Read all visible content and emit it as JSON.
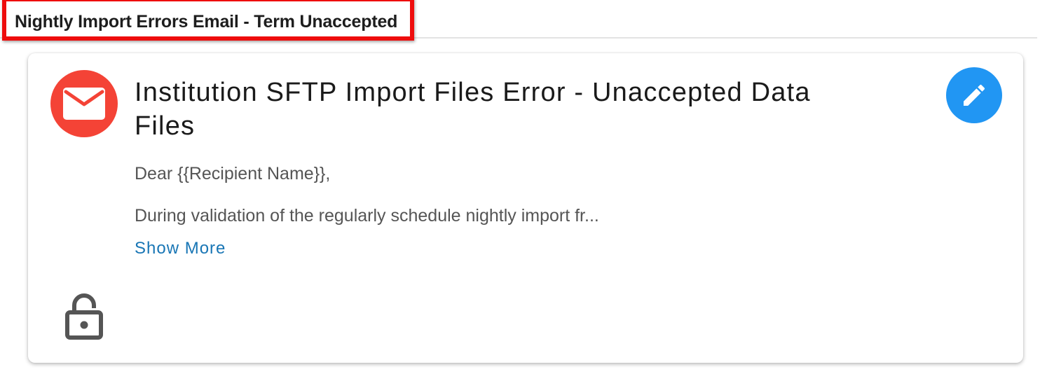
{
  "section": {
    "title": "Nightly Import Errors Email - Term Unaccepted"
  },
  "card": {
    "avatar_icon": "mail-icon",
    "title": "Institution SFTP Import Files Error - Unaccepted Data Files",
    "greeting": "Dear {{Recipient Name}},",
    "preview": "During validation of the regularly schedule nightly import fr...",
    "show_more_label": "Show More",
    "edit_icon": "pencil-icon",
    "lock_icon": "unlocked-lock-icon"
  },
  "colors": {
    "avatar_bg": "#f44336",
    "edit_button_bg": "#2196f3",
    "link": "#1976b5",
    "highlight": "#ee0d0d"
  }
}
